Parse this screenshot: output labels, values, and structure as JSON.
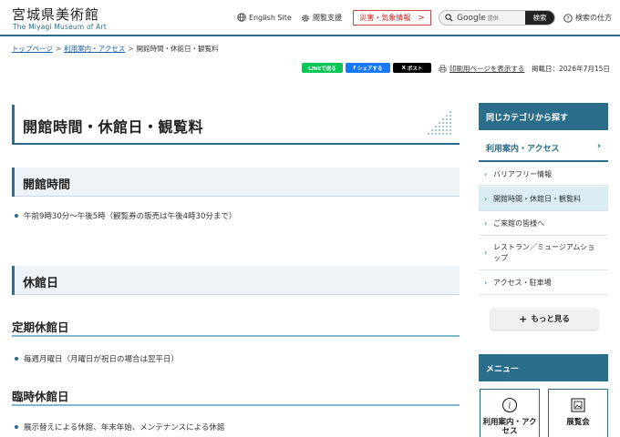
{
  "header": {
    "logo_jp": "宮城県美術館",
    "logo_en": "The Miyagi Museum of Art",
    "english_site": "English Site",
    "viewing_support": "閲覧支援",
    "disaster_info": "災害・気象情報",
    "search_placeholder": "Google",
    "search_placeholder_small": "提供",
    "search_button": "検索",
    "search_help": "検索の仕方"
  },
  "breadcrumb": {
    "home": "トップページ",
    "parent": "利用案内・アクセス",
    "current": "開館時間・休館日・観覧料",
    "sep": ">"
  },
  "share": {
    "line": "LINEで送る",
    "facebook": "シェアする",
    "x": "ポスト",
    "print": "印刷用ページを表示する",
    "pubdate": "掲載日：2026年7月15日"
  },
  "main": {
    "title": "開館時間・休館日・観覧料",
    "section_hours": "開館時間",
    "hours_item": "午前9時30分～午後5時（観覧券の販売は午後4時30分まで）",
    "section_closed": "休館日",
    "regular_closed": "定期休館日",
    "regular_item": "毎週月曜日（月曜日が祝日の場合は翌平日）",
    "temp_closed": "臨時休館日",
    "temp_item": "展示替えによる休館、年末年始、メンテナンスによる休館"
  },
  "sidebar": {
    "same_category": "同じカテゴリから探す",
    "category": "利用案内・アクセス",
    "items": [
      {
        "label": "バリアフリー情報"
      },
      {
        "label": "開館時間・休館日・観覧料"
      },
      {
        "label": "ご来館の皆様へ"
      },
      {
        "label": "レストラン／ミュージアムショップ"
      },
      {
        "label": "アクセス・駐車場"
      }
    ],
    "more": "もっと見る",
    "menu_head": "メニュー",
    "menu_cards": [
      {
        "label": "利用案内・アクセス"
      },
      {
        "label": "展覧会"
      }
    ]
  },
  "colors": {
    "accent": "#2a6e8c",
    "line_green": "#06c755",
    "facebook_blue": "#1877f2",
    "x_black": "#000000",
    "disaster_red": "#cc2222"
  }
}
